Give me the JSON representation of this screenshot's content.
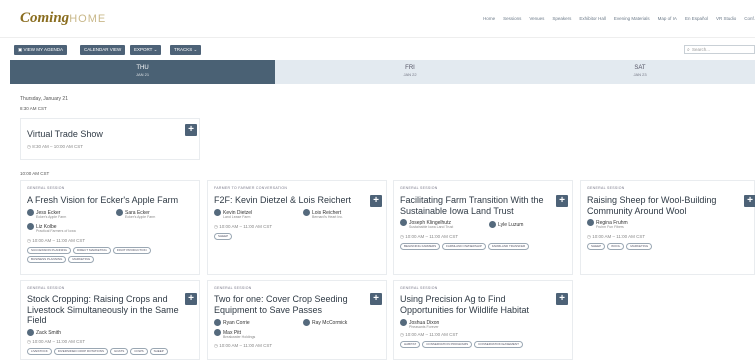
{
  "brand": {
    "logo_script": "Coming",
    "logo_word": "HOME"
  },
  "nav_items": [
    "Home",
    "Sessions",
    "Venues",
    "Speakers",
    "Exhibitor Hall",
    "Evening Materials",
    "Map of IA",
    "En Español",
    "VR Studio",
    "Conf."
  ],
  "toolbar": {
    "agenda": "VIEW MY AGENDA",
    "calendar": "CALENDAR VIEW",
    "export": "EXPORT ⌄",
    "tracks": "TRACKS ⌄",
    "search_placeholder": "Search..."
  },
  "days": [
    {
      "name": "THU",
      "date": "JAN 21"
    },
    {
      "name": "FRI",
      "date": "JAN 22"
    },
    {
      "name": "SAT",
      "date": "JAN 23"
    }
  ],
  "date_heading": "Thursday, January 21",
  "slot_1_time": "8:30 AM CST",
  "slot_2_time": "10:00 AM CST",
  "sessions": [
    {
      "category": "",
      "title": "Virtual Trade Show",
      "time": "8:30 AM – 10:00 AM CST",
      "speakers": [],
      "tags": []
    },
    {
      "category": "GENERAL SESSION",
      "title": "A Fresh Vision for Ecker's Apple Farm",
      "time": "10:00 AM – 11:00 AM CST",
      "speakers": [
        {
          "name": "Jess Ecker",
          "org": "Ecker's Apple Farm"
        },
        {
          "name": "Sara Ecker",
          "org": "Ecker's Apple Farm"
        },
        {
          "name": "Liz Kolbe",
          "org": "Practical Farmers of Iowa"
        }
      ],
      "tags": [
        "SUCCESSION PLANNING",
        "DIRECT MARKETING",
        "FRUIT PRODUCTION",
        "BUSINESS PLANNING",
        "MARKETING"
      ]
    },
    {
      "category": "FARMER TO FARMER CONVERSATION",
      "title": "F2F: Kevin Dietzel & Lois Reichert",
      "time": "10:00 AM – 11:00 AM CST",
      "speakers": [
        {
          "name": "Kevin Dietzel",
          "org": "Land Lease Farm"
        },
        {
          "name": "Lois Reichert",
          "org": "Bernard's Heart Inc."
        }
      ],
      "tags": [
        "SHEEP"
      ]
    },
    {
      "category": "GENERAL SESSION",
      "title": "Facilitating Farm Transition With the Sustainable Iowa Land Trust",
      "time": "10:00 AM – 11:00 AM CST",
      "speakers": [
        {
          "name": "Joseph Klingelhutz",
          "org": "Sustainable Iowa Land Trust"
        },
        {
          "name": "Lyle Luzum",
          "org": ""
        }
      ],
      "tags": [
        "BEGINNING FARMERS",
        "FARMLAND OWNERSHIP",
        "FARMLAND TRANSFER"
      ]
    },
    {
      "category": "GENERAL SESSION",
      "title": "Raising Sheep for Wool-Building Community Around Wool",
      "time": "10:00 AM – 11:00 AM CST",
      "speakers": [
        {
          "name": "Regina Fruhm",
          "org": "Fruhm Fun Fibers"
        }
      ],
      "tags": [
        "SHEEP",
        "WOOL",
        "MARKETING"
      ]
    },
    {
      "category": "GENERAL SESSION",
      "title": "Stock Cropping: Raising Crops and Livestock Simultaneously in the Same Field",
      "time": "10:00 AM – 11:00 AM CST",
      "speakers": [
        {
          "name": "Zack Smith",
          "org": ""
        }
      ],
      "tags": [
        "LIVESTOCK",
        "DIVERSIFIED CROP ROTATIONS",
        "GOATS",
        "COWS",
        "SHEEP"
      ]
    },
    {
      "category": "GENERAL SESSION",
      "title": "Two for one: Cover Crop Seeding Equipment to Save Passes",
      "time": "10:00 AM – 11:00 AM CST",
      "speakers": [
        {
          "name": "Ryan Corrie",
          "org": ""
        },
        {
          "name": "Ray McCormick",
          "org": ""
        },
        {
          "name": "Max Pitt",
          "org": "Breakwater Holdings"
        }
      ],
      "tags": []
    },
    {
      "category": "GENERAL SESSION",
      "title": "Using Precision Ag to Find Opportunities for Wildlife Habitat",
      "time": "10:00 AM – 11:00 AM CST",
      "speakers": [
        {
          "name": "Joshua Dixon",
          "org": "Pheasants Forever"
        }
      ],
      "tags": [
        "HABITAT",
        "CONSERVATION PROGRAMS",
        "CONSERVATION EASEMENT"
      ]
    }
  ],
  "colors": {
    "accent": "#4d6277",
    "brand": "#8a6d1f",
    "daybar": "#e3eaf0"
  }
}
